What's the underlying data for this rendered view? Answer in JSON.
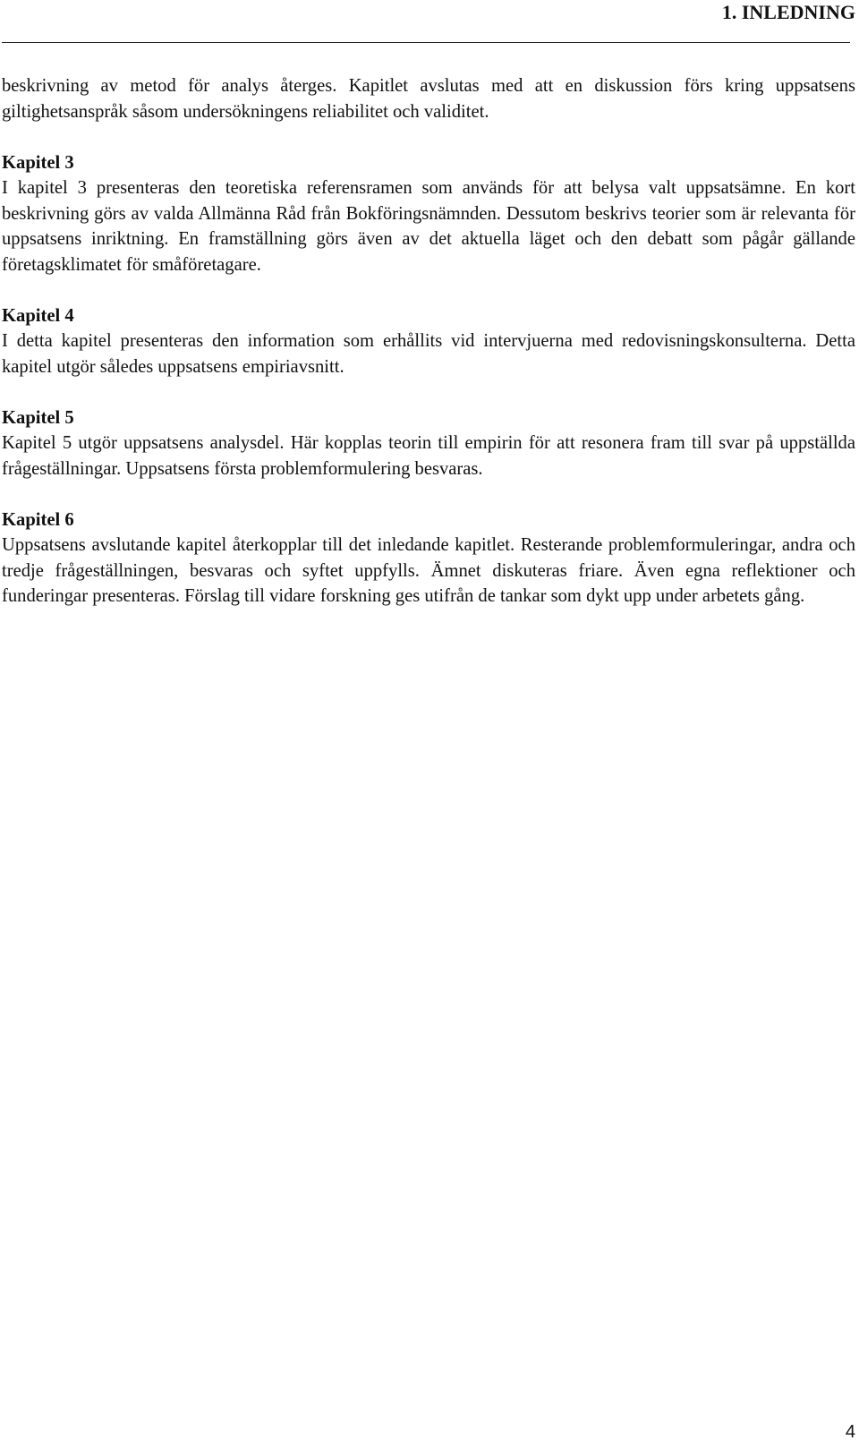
{
  "header": {
    "title": "1. INLEDNING"
  },
  "intro_paragraph": "beskrivning av metod för analys återges. Kapitlet avslutas med att en diskussion förs kring uppsatsens giltighetsanspråk såsom undersökningens reliabilitet och validitet.",
  "chapters": [
    {
      "heading": "Kapitel 3",
      "text": "I kapitel 3 presenteras den teoretiska referensramen som används för att belysa valt uppsatsämne. En kort beskrivning görs av valda Allmänna Råd från Bokföringsnämnden. Dessutom beskrivs teorier som är relevanta för uppsatsens inriktning.  En framställning görs även av det aktuella läget och den debatt som pågår gällande företagsklimatet för småföretagare."
    },
    {
      "heading": "Kapitel 4",
      "text": "I detta kapitel presenteras den information som erhållits vid intervjuerna med redovisningskonsulterna. Detta kapitel utgör således uppsatsens empiriavsnitt."
    },
    {
      "heading": "Kapitel 5",
      "text": "Kapitel 5 utgör uppsatsens analysdel. Här kopplas teorin till empirin för att resonera fram till svar på uppställda frågeställningar. Uppsatsens första problemformulering besvaras."
    },
    {
      "heading": "Kapitel 6",
      "text": "Uppsatsens avslutande kapitel återkopplar till det inledande kapitlet. Resterande problemformuleringar, andra och tredje frågeställningen, besvaras och syftet uppfylls. Ämnet diskuteras friare. Även egna reflektioner och funderingar presenteras. Förslag till vidare forskning ges utifrån de tankar som dykt upp under arbetets gång."
    }
  ],
  "footer": {
    "page_number": "4"
  }
}
